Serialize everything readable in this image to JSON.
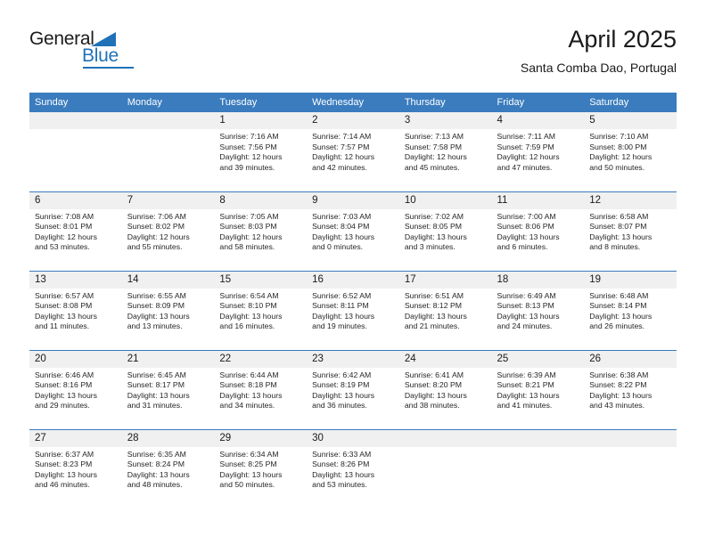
{
  "logo": {
    "word1": "General",
    "word2": "Blue",
    "triangle_icon": "blue-triangle-icon",
    "accent_color": "#1f72b8"
  },
  "header": {
    "title": "April 2025",
    "subtitle": "Santa Comba Dao, Portugal"
  },
  "calendar": {
    "header_color": "#3a7cbe",
    "daynum_bg": "#f0f0f0",
    "weekday_headers": [
      "Sunday",
      "Monday",
      "Tuesday",
      "Wednesday",
      "Thursday",
      "Friday",
      "Saturday"
    ],
    "weeks": [
      [
        {
          "day": "",
          "sunrise": "",
          "sunset": "",
          "daylight1": "",
          "daylight2": ""
        },
        {
          "day": "",
          "sunrise": "",
          "sunset": "",
          "daylight1": "",
          "daylight2": ""
        },
        {
          "day": "1",
          "sunrise": "Sunrise: 7:16 AM",
          "sunset": "Sunset: 7:56 PM",
          "daylight1": "Daylight: 12 hours",
          "daylight2": "and 39 minutes."
        },
        {
          "day": "2",
          "sunrise": "Sunrise: 7:14 AM",
          "sunset": "Sunset: 7:57 PM",
          "daylight1": "Daylight: 12 hours",
          "daylight2": "and 42 minutes."
        },
        {
          "day": "3",
          "sunrise": "Sunrise: 7:13 AM",
          "sunset": "Sunset: 7:58 PM",
          "daylight1": "Daylight: 12 hours",
          "daylight2": "and 45 minutes."
        },
        {
          "day": "4",
          "sunrise": "Sunrise: 7:11 AM",
          "sunset": "Sunset: 7:59 PM",
          "daylight1": "Daylight: 12 hours",
          "daylight2": "and 47 minutes."
        },
        {
          "day": "5",
          "sunrise": "Sunrise: 7:10 AM",
          "sunset": "Sunset: 8:00 PM",
          "daylight1": "Daylight: 12 hours",
          "daylight2": "and 50 minutes."
        }
      ],
      [
        {
          "day": "6",
          "sunrise": "Sunrise: 7:08 AM",
          "sunset": "Sunset: 8:01 PM",
          "daylight1": "Daylight: 12 hours",
          "daylight2": "and 53 minutes."
        },
        {
          "day": "7",
          "sunrise": "Sunrise: 7:06 AM",
          "sunset": "Sunset: 8:02 PM",
          "daylight1": "Daylight: 12 hours",
          "daylight2": "and 55 minutes."
        },
        {
          "day": "8",
          "sunrise": "Sunrise: 7:05 AM",
          "sunset": "Sunset: 8:03 PM",
          "daylight1": "Daylight: 12 hours",
          "daylight2": "and 58 minutes."
        },
        {
          "day": "9",
          "sunrise": "Sunrise: 7:03 AM",
          "sunset": "Sunset: 8:04 PM",
          "daylight1": "Daylight: 13 hours",
          "daylight2": "and 0 minutes."
        },
        {
          "day": "10",
          "sunrise": "Sunrise: 7:02 AM",
          "sunset": "Sunset: 8:05 PM",
          "daylight1": "Daylight: 13 hours",
          "daylight2": "and 3 minutes."
        },
        {
          "day": "11",
          "sunrise": "Sunrise: 7:00 AM",
          "sunset": "Sunset: 8:06 PM",
          "daylight1": "Daylight: 13 hours",
          "daylight2": "and 6 minutes."
        },
        {
          "day": "12",
          "sunrise": "Sunrise: 6:58 AM",
          "sunset": "Sunset: 8:07 PM",
          "daylight1": "Daylight: 13 hours",
          "daylight2": "and 8 minutes."
        }
      ],
      [
        {
          "day": "13",
          "sunrise": "Sunrise: 6:57 AM",
          "sunset": "Sunset: 8:08 PM",
          "daylight1": "Daylight: 13 hours",
          "daylight2": "and 11 minutes."
        },
        {
          "day": "14",
          "sunrise": "Sunrise: 6:55 AM",
          "sunset": "Sunset: 8:09 PM",
          "daylight1": "Daylight: 13 hours",
          "daylight2": "and 13 minutes."
        },
        {
          "day": "15",
          "sunrise": "Sunrise: 6:54 AM",
          "sunset": "Sunset: 8:10 PM",
          "daylight1": "Daylight: 13 hours",
          "daylight2": "and 16 minutes."
        },
        {
          "day": "16",
          "sunrise": "Sunrise: 6:52 AM",
          "sunset": "Sunset: 8:11 PM",
          "daylight1": "Daylight: 13 hours",
          "daylight2": "and 19 minutes."
        },
        {
          "day": "17",
          "sunrise": "Sunrise: 6:51 AM",
          "sunset": "Sunset: 8:12 PM",
          "daylight1": "Daylight: 13 hours",
          "daylight2": "and 21 minutes."
        },
        {
          "day": "18",
          "sunrise": "Sunrise: 6:49 AM",
          "sunset": "Sunset: 8:13 PM",
          "daylight1": "Daylight: 13 hours",
          "daylight2": "and 24 minutes."
        },
        {
          "day": "19",
          "sunrise": "Sunrise: 6:48 AM",
          "sunset": "Sunset: 8:14 PM",
          "daylight1": "Daylight: 13 hours",
          "daylight2": "and 26 minutes."
        }
      ],
      [
        {
          "day": "20",
          "sunrise": "Sunrise: 6:46 AM",
          "sunset": "Sunset: 8:16 PM",
          "daylight1": "Daylight: 13 hours",
          "daylight2": "and 29 minutes."
        },
        {
          "day": "21",
          "sunrise": "Sunrise: 6:45 AM",
          "sunset": "Sunset: 8:17 PM",
          "daylight1": "Daylight: 13 hours",
          "daylight2": "and 31 minutes."
        },
        {
          "day": "22",
          "sunrise": "Sunrise: 6:44 AM",
          "sunset": "Sunset: 8:18 PM",
          "daylight1": "Daylight: 13 hours",
          "daylight2": "and 34 minutes."
        },
        {
          "day": "23",
          "sunrise": "Sunrise: 6:42 AM",
          "sunset": "Sunset: 8:19 PM",
          "daylight1": "Daylight: 13 hours",
          "daylight2": "and 36 minutes."
        },
        {
          "day": "24",
          "sunrise": "Sunrise: 6:41 AM",
          "sunset": "Sunset: 8:20 PM",
          "daylight1": "Daylight: 13 hours",
          "daylight2": "and 38 minutes."
        },
        {
          "day": "25",
          "sunrise": "Sunrise: 6:39 AM",
          "sunset": "Sunset: 8:21 PM",
          "daylight1": "Daylight: 13 hours",
          "daylight2": "and 41 minutes."
        },
        {
          "day": "26",
          "sunrise": "Sunrise: 6:38 AM",
          "sunset": "Sunset: 8:22 PM",
          "daylight1": "Daylight: 13 hours",
          "daylight2": "and 43 minutes."
        }
      ],
      [
        {
          "day": "27",
          "sunrise": "Sunrise: 6:37 AM",
          "sunset": "Sunset: 8:23 PM",
          "daylight1": "Daylight: 13 hours",
          "daylight2": "and 46 minutes."
        },
        {
          "day": "28",
          "sunrise": "Sunrise: 6:35 AM",
          "sunset": "Sunset: 8:24 PM",
          "daylight1": "Daylight: 13 hours",
          "daylight2": "and 48 minutes."
        },
        {
          "day": "29",
          "sunrise": "Sunrise: 6:34 AM",
          "sunset": "Sunset: 8:25 PM",
          "daylight1": "Daylight: 13 hours",
          "daylight2": "and 50 minutes."
        },
        {
          "day": "30",
          "sunrise": "Sunrise: 6:33 AM",
          "sunset": "Sunset: 8:26 PM",
          "daylight1": "Daylight: 13 hours",
          "daylight2": "and 53 minutes."
        },
        {
          "day": "",
          "sunrise": "",
          "sunset": "",
          "daylight1": "",
          "daylight2": ""
        },
        {
          "day": "",
          "sunrise": "",
          "sunset": "",
          "daylight1": "",
          "daylight2": ""
        },
        {
          "day": "",
          "sunrise": "",
          "sunset": "",
          "daylight1": "",
          "daylight2": ""
        }
      ]
    ]
  }
}
